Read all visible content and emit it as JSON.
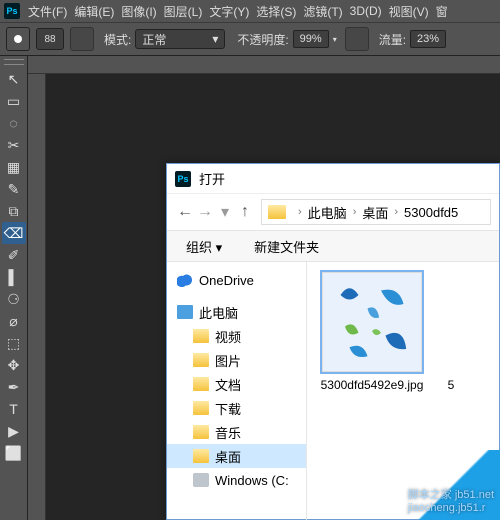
{
  "menubar": {
    "items": [
      "文件(F)",
      "编辑(E)",
      "图像(I)",
      "图层(L)",
      "文字(Y)",
      "选择(S)",
      "滤镜(T)",
      "3D(D)",
      "视图(V)",
      "窗"
    ]
  },
  "options": {
    "brush_size": "88",
    "mode_label": "模式:",
    "mode_value": "正常",
    "opacity_label": "不透明度:",
    "opacity_value": "99%",
    "flow_label": "流量:",
    "flow_value": "23%"
  },
  "tools": {
    "items": [
      "↖",
      "▭",
      "◌",
      "✂",
      "▦",
      "✎",
      "⧉",
      "⌫",
      "✐",
      "▌",
      "⚆",
      "⌀",
      "⬚",
      "✥",
      "✒",
      "T",
      "▶",
      "⬜"
    ]
  },
  "dialog": {
    "title": "打开",
    "breadcrumb": [
      "此电脑",
      "桌面",
      "5300dfd5"
    ],
    "toolbar": {
      "organize": "组织",
      "new_folder": "新建文件夹"
    },
    "tree": [
      {
        "label": "OneDrive",
        "icon": "cloud",
        "indent": false
      },
      {
        "label": "此电脑",
        "icon": "pc",
        "indent": false
      },
      {
        "label": "视频",
        "icon": "folder",
        "indent": true
      },
      {
        "label": "图片",
        "icon": "folder",
        "indent": true
      },
      {
        "label": "文档",
        "icon": "folder",
        "indent": true
      },
      {
        "label": "下载",
        "icon": "folder",
        "indent": true
      },
      {
        "label": "音乐",
        "icon": "folder",
        "indent": true
      },
      {
        "label": "桌面",
        "icon": "folder",
        "indent": true,
        "selected": true
      },
      {
        "label": "Windows (C:",
        "icon": "disk",
        "indent": true
      }
    ],
    "files": [
      {
        "name": "5300dfd5492e9.jpg",
        "selected": true
      },
      {
        "name": "5",
        "selected": false
      }
    ]
  },
  "watermark": {
    "site": "脚本之家 jb51.net",
    "url": "jiaocheng.jb51.r"
  }
}
